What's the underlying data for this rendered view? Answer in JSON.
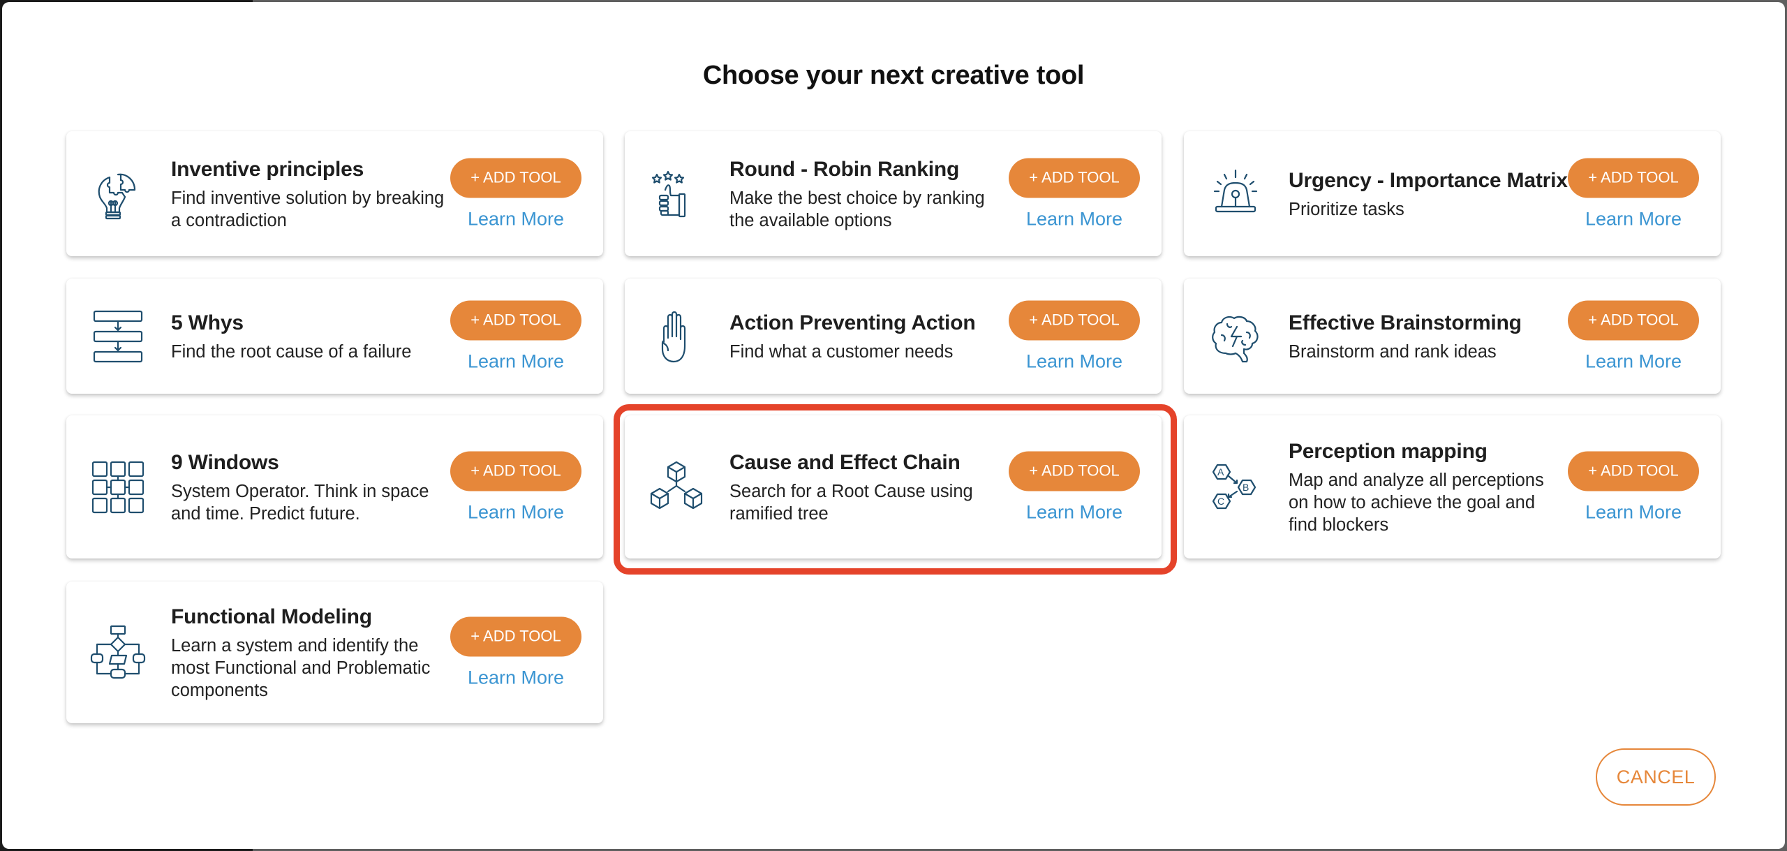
{
  "dialog": {
    "title": "Choose your next creative tool",
    "cancel_label": "CANCEL",
    "highlighted_tool": "Cause and Effect Chain"
  },
  "colors": {
    "accent_orange": "#E6873A",
    "link_blue": "#3B95D2",
    "icon_navy": "#1F4E6E",
    "highlight_red": "#E5432A"
  },
  "tools": [
    {
      "title": "Inventive principles",
      "description": "Find inventive solution by breaking a contradiction",
      "icon": "lightbulb-puzzle-icon",
      "add_label": "+ ADD TOOL",
      "learn_label": "Learn More"
    },
    {
      "title": "Round - Robin Ranking",
      "description": "Make the best choice by ranking the available options",
      "icon": "thumbs-up-stars-icon",
      "add_label": "+ ADD TOOL",
      "learn_label": "Learn More"
    },
    {
      "title": "Urgency - Importance Matrix",
      "description": "Prioritize tasks",
      "icon": "siren-icon",
      "add_label": "+ ADD TOOL",
      "learn_label": "Learn More"
    },
    {
      "title": "5 Whys",
      "description": "Find the root cause of a failure",
      "icon": "stacked-steps-icon",
      "add_label": "+ ADD TOOL",
      "learn_label": "Learn More"
    },
    {
      "title": "Action Preventing Action",
      "description": "Find what a customer needs",
      "icon": "raised-hand-icon",
      "add_label": "+ ADD TOOL",
      "learn_label": "Learn More"
    },
    {
      "title": "Effective Brainstorming",
      "description": "Brainstorm and rank ideas",
      "icon": "brain-lightning-icon",
      "add_label": "+ ADD TOOL",
      "learn_label": "Learn More"
    },
    {
      "title": "9 Windows",
      "description": "System Operator. Think in space and time. Predict future.",
      "icon": "nine-windows-grid-icon",
      "add_label": "+ ADD TOOL",
      "learn_label": "Learn More"
    },
    {
      "title": "Cause and Effect Chain",
      "description": "Search for a Root Cause using ramified tree",
      "icon": "cubes-tree-icon",
      "add_label": "+ ADD TOOL",
      "learn_label": "Learn More"
    },
    {
      "title": "Perception mapping",
      "description": "Map and analyze all perceptions on how to achieve the goal and find blockers",
      "icon": "hexagon-abc-icon",
      "add_label": "+ ADD TOOL",
      "learn_label": "Learn More"
    },
    {
      "title": "Functional Modeling",
      "description": "Learn a system and identify the most Functional and Problematic components",
      "icon": "flowchart-icon",
      "add_label": "+ ADD TOOL",
      "learn_label": "Learn More"
    }
  ],
  "icon_letters": {
    "a": "A",
    "b": "B",
    "c": "C"
  }
}
